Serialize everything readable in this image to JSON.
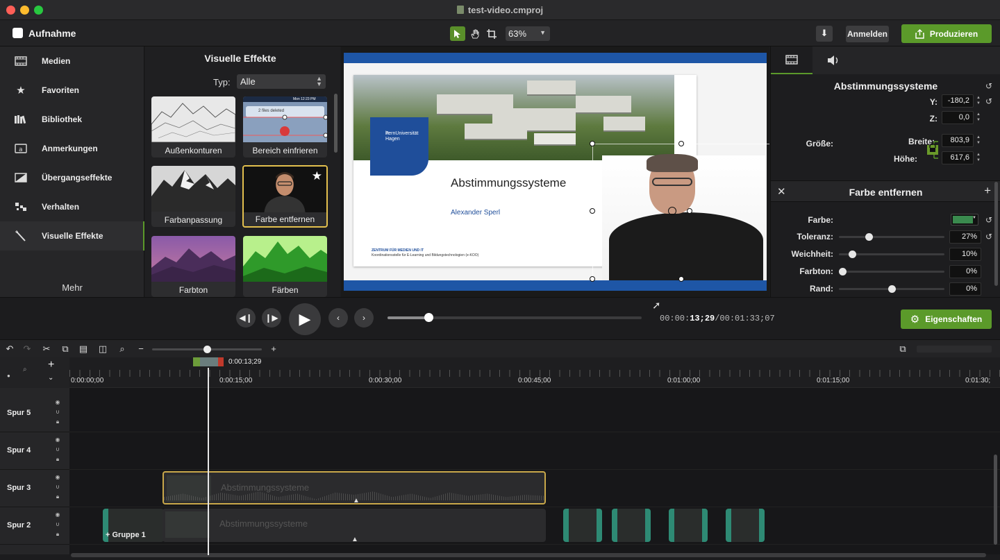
{
  "window": {
    "title": "test-video.cmproj"
  },
  "toolbar": {
    "record_label": "Aufnahme",
    "zoom": "63%",
    "login_label": "Anmelden",
    "produce_label": "Produzieren"
  },
  "sidebar": {
    "items": [
      {
        "label": "Medien",
        "icon": "film-icon"
      },
      {
        "label": "Favoriten",
        "icon": "star-icon"
      },
      {
        "label": "Bibliothek",
        "icon": "library-icon"
      },
      {
        "label": "Anmerkungen",
        "icon": "annotation-icon"
      },
      {
        "label": "Übergangseffekte",
        "icon": "transition-icon"
      },
      {
        "label": "Verhalten",
        "icon": "behavior-icon"
      },
      {
        "label": "Visuelle Effekte",
        "icon": "wand-icon"
      }
    ],
    "active_index": 6,
    "more_label": "Mehr"
  },
  "effects": {
    "title": "Visuelle Effekte",
    "type_label": "Typ:",
    "type_value": "Alle",
    "tiles": [
      {
        "label": "Außenkonturen"
      },
      {
        "label": "Bereich einfrieren",
        "thumb_text": "2 files deleted",
        "thumb_time": "Mon 12:23 PM"
      },
      {
        "label": "Farbanpassung"
      },
      {
        "label": "Farbe entfernen",
        "selected": true
      },
      {
        "label": "Farbton"
      },
      {
        "label": "Färben"
      }
    ]
  },
  "slide": {
    "logo_text_1": "FernUniversität",
    "logo_text_2": "in Hagen",
    "heading": "Abstimmungssysteme",
    "author": "Alexander Sperl",
    "footer_bold": "ZENTRUM FÜR MEDIEN UND IT",
    "footer_line": "Koordinationsstelle für E-Learning und Bildungstechnologien (e-KOO)"
  },
  "properties": {
    "title": "Abstimmungssysteme",
    "y_label": "Y:",
    "y_value": "-180,2",
    "z_label": "Z:",
    "z_value": "0,0",
    "size_label": "Größe:",
    "width_label": "Breite:",
    "width_value": "803,9",
    "height_label": "Höhe:",
    "height_value": "617,6",
    "effect_title": "Farbe entfernen",
    "color_label": "Farbe:",
    "color_hex": "#3a8a4e",
    "tolerance_label": "Toleranz:",
    "tolerance_value": "27%",
    "tolerance_fraction": 0.27,
    "softness_label": "Weichheit:",
    "softness_value": "10%",
    "softness_fraction": 0.1,
    "hue_label": "Farbton:",
    "hue_value": "0%",
    "hue_fraction": 0.0,
    "edge_label": "Rand:",
    "edge_value": "0%",
    "edge_fraction": 0.5
  },
  "playback": {
    "current_time_prefix": "00:00:",
    "current_time_bold": "13;29",
    "total_time": "/00:01:33;07",
    "progress_fraction": 0.16,
    "properties_label": "Eigenschaften"
  },
  "timeline": {
    "playhead_time": "0:00:13;29",
    "ruler_labels": [
      "0:00:00;00",
      "0:00:15;00",
      "0:00:30;00",
      "0:00:45;00",
      "0:01:00;00",
      "0:01:15;00",
      "0:01:30;"
    ],
    "tracks": [
      {
        "name": "Spur 5"
      },
      {
        "name": "Spur 4"
      },
      {
        "name": "Spur 3",
        "clip_label": "Abstimmungssysteme"
      },
      {
        "name": "Spur 2",
        "clip_label": "Abstimmungssysteme"
      }
    ],
    "group_label": "Gruppe 1",
    "zoom_fraction": 0.5
  },
  "colors": {
    "accent_green": "#5b9a2a",
    "selection_yellow": "#e3c04e",
    "slide_blue": "#1e56a6",
    "clip_teal": "#2e8a74"
  }
}
